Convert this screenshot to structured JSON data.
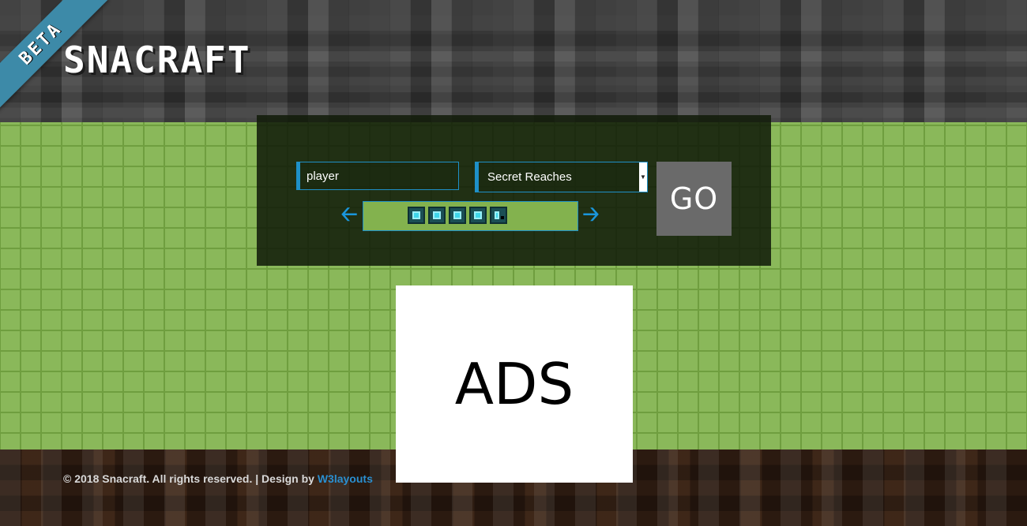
{
  "brand": {
    "logo_text": "SNACRAFT",
    "ribbon_label": "BETA"
  },
  "search": {
    "player_value": "player",
    "server_selected": "Secret Reaches",
    "go_label": "GO",
    "prev_icon": "arrow-left-icon",
    "next_icon": "arrow-right-icon"
  },
  "hotbar": {
    "full_slots": 4,
    "partial_slots": 1
  },
  "ad": {
    "label": "ADS"
  },
  "footer": {
    "copyright": "© 2018 Snacraft. All rights reserved. | Design by ",
    "designer_link": "W3layouts"
  },
  "colors": {
    "accent": "#1e90c8",
    "grass": "#8ab85a",
    "panel": "#121c0a",
    "go_button": "#6a6a6a"
  }
}
